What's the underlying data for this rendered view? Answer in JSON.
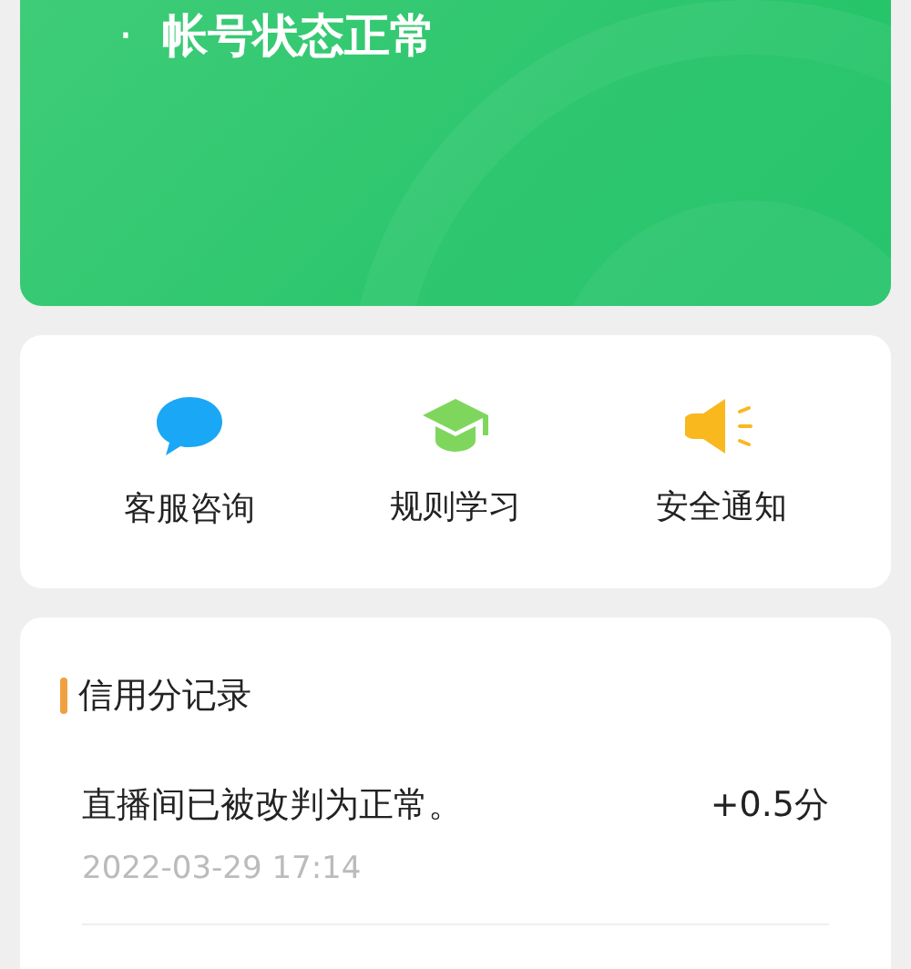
{
  "status_card": {
    "bullet": "·",
    "text": "帐号状态正常"
  },
  "shortcuts": [
    {
      "kind": "chat",
      "label": "客服咨询"
    },
    {
      "kind": "graduation",
      "label": "规则学习"
    },
    {
      "kind": "speaker",
      "label": "安全通知"
    }
  ],
  "records": {
    "title": "信用分记录",
    "items": [
      {
        "text": "直播间已被改判为正常。",
        "points": "+0.5分",
        "time": "2022-03-29 17:14"
      }
    ]
  }
}
